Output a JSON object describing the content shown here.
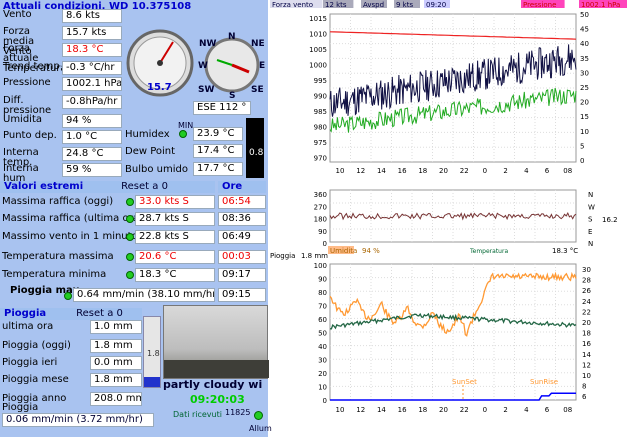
{
  "current": {
    "header": "Attuali condizioni, WD 10.375108",
    "rows": [
      {
        "label": "Vento",
        "value": "8.6 kts"
      },
      {
        "label": "Forza media Vento",
        "value": "15.7 kts"
      },
      {
        "label": "Forza attuale Temperatura",
        "value": "18.3 °C",
        "red": true
      },
      {
        "label": "Trend temp",
        "value": "-0.3 °C/hr"
      },
      {
        "label": "Pressione",
        "value": "1002.1 hPa"
      },
      {
        "label": "Diff. pressione",
        "value": "-0.8hPa/hr"
      },
      {
        "label": "Umidita",
        "value": "94 %"
      },
      {
        "label": "Punto dep.",
        "value": "1.0 °C"
      },
      {
        "label": "Interna temp.",
        "value": "24.8 °C"
      },
      {
        "label": "Interna hum",
        "value": "59 %"
      }
    ],
    "gauge_value": "15.7",
    "compass_labels": {
      "n": "N",
      "nw": "NW",
      "ne": "NE",
      "w": "W",
      "e": "E",
      "sw": "SW",
      "s": "S",
      "se": "SE"
    },
    "wind_dir": "ESE  112 °",
    "humidex_label": "Humidex",
    "humidex": "23.9 °C",
    "dewpoint_label": "Dew Point",
    "dewpoint": "17.4 °C",
    "wetbulb_label": "Bulbo umido",
    "wetbulb": "17.7 °C",
    "mini_label": "MIN",
    "bar_value": "0.8"
  },
  "extremes": {
    "header": "Valori estremi",
    "reset": "Reset a 0",
    "ore": "Ore",
    "rows": [
      {
        "label": "Massima raffica (oggi)",
        "value": "33.0 kts   S",
        "time": "06:54",
        "red": true
      },
      {
        "label": "Massima raffica (ultima ora)",
        "value": "28.7 kts   S",
        "time": "08:36"
      },
      {
        "label": "Massimo vento in 1 minuto",
        "value": "22.8 kts   S",
        "time": "06:49"
      },
      {
        "label": "Temperatura massima",
        "value": "20.6 °C",
        "time": "00:03",
        "red": true
      },
      {
        "label": "Temperatura minima",
        "value": "18.3 °C",
        "time": "09:17"
      }
    ],
    "rain_max_label": "Pioggia max",
    "rain_max": "0.64 mm/min (38.10 mm/hr",
    "rain_max_time": "09:15"
  },
  "rain": {
    "header": "Pioggia",
    "reset": "Reset a 0",
    "rows": [
      {
        "label": "ultima ora",
        "value": "1.0 mm"
      },
      {
        "label": "Pioggia (oggi)",
        "value": "1.8 mm"
      },
      {
        "label": "Pioggia ieri",
        "value": "0.0 mm"
      },
      {
        "label": "Pioggia mese",
        "value": "1.8 mm"
      },
      {
        "label": "Pioggia anno",
        "value": "208.0 mm"
      }
    ],
    "rate_label": "Pioggia",
    "rate": "0.06 mm/min (3.72 mm/hr)",
    "bar_label": "1.8"
  },
  "webcam": {
    "condition": "partly cloudy wi",
    "time": "09:20:03",
    "rx_label": "Dati ricevuti",
    "rx_count": "11825",
    "alarm": "Allum"
  },
  "graph1": {
    "legend": [
      "Forza vento",
      "12 kts",
      "Avspd",
      "9 kts",
      "09:20",
      "Pressione",
      "1002.1 hPa"
    ],
    "left_ticks": [
      "1015",
      "1010",
      "1005",
      "1000",
      "995",
      "990",
      "985",
      "980",
      "975",
      "970"
    ],
    "right_ticks": [
      "50",
      "45",
      "40",
      "35",
      "30",
      "25",
      "20",
      "15",
      "10",
      "5",
      "0"
    ],
    "x_ticks": [
      "10",
      "12",
      "14",
      "16",
      "18",
      "20",
      "22",
      "0",
      "2",
      "4",
      "6",
      "08"
    ]
  },
  "graph2": {
    "left_ticks": [
      "360",
      "270",
      "180",
      "90",
      "0"
    ],
    "right_labels": [
      "N",
      "W",
      "S",
      "E",
      "N"
    ],
    "right_value": "16.2"
  },
  "graph3": {
    "legend": [
      "Umidita",
      "94 %",
      "Temperatura",
      "18.3 °C"
    ],
    "rain_label": "Pioggia",
    "rain_value": "1.8 mm",
    "left_ticks": [
      "100",
      "90",
      "80",
      "70",
      "60",
      "50",
      "40",
      "30",
      "20",
      "10",
      "0"
    ],
    "right_ticks": [
      "30",
      "28",
      "26",
      "24",
      "22",
      "20",
      "18",
      "16",
      "14",
      "12",
      "10",
      "8",
      "6"
    ],
    "x_ticks": [
      "10",
      "12",
      "14",
      "16",
      "18",
      "20",
      "22",
      "0",
      "2",
      "4",
      "6",
      "08"
    ],
    "sunset": "SunSet",
    "sunrise": "SunRise"
  }
}
